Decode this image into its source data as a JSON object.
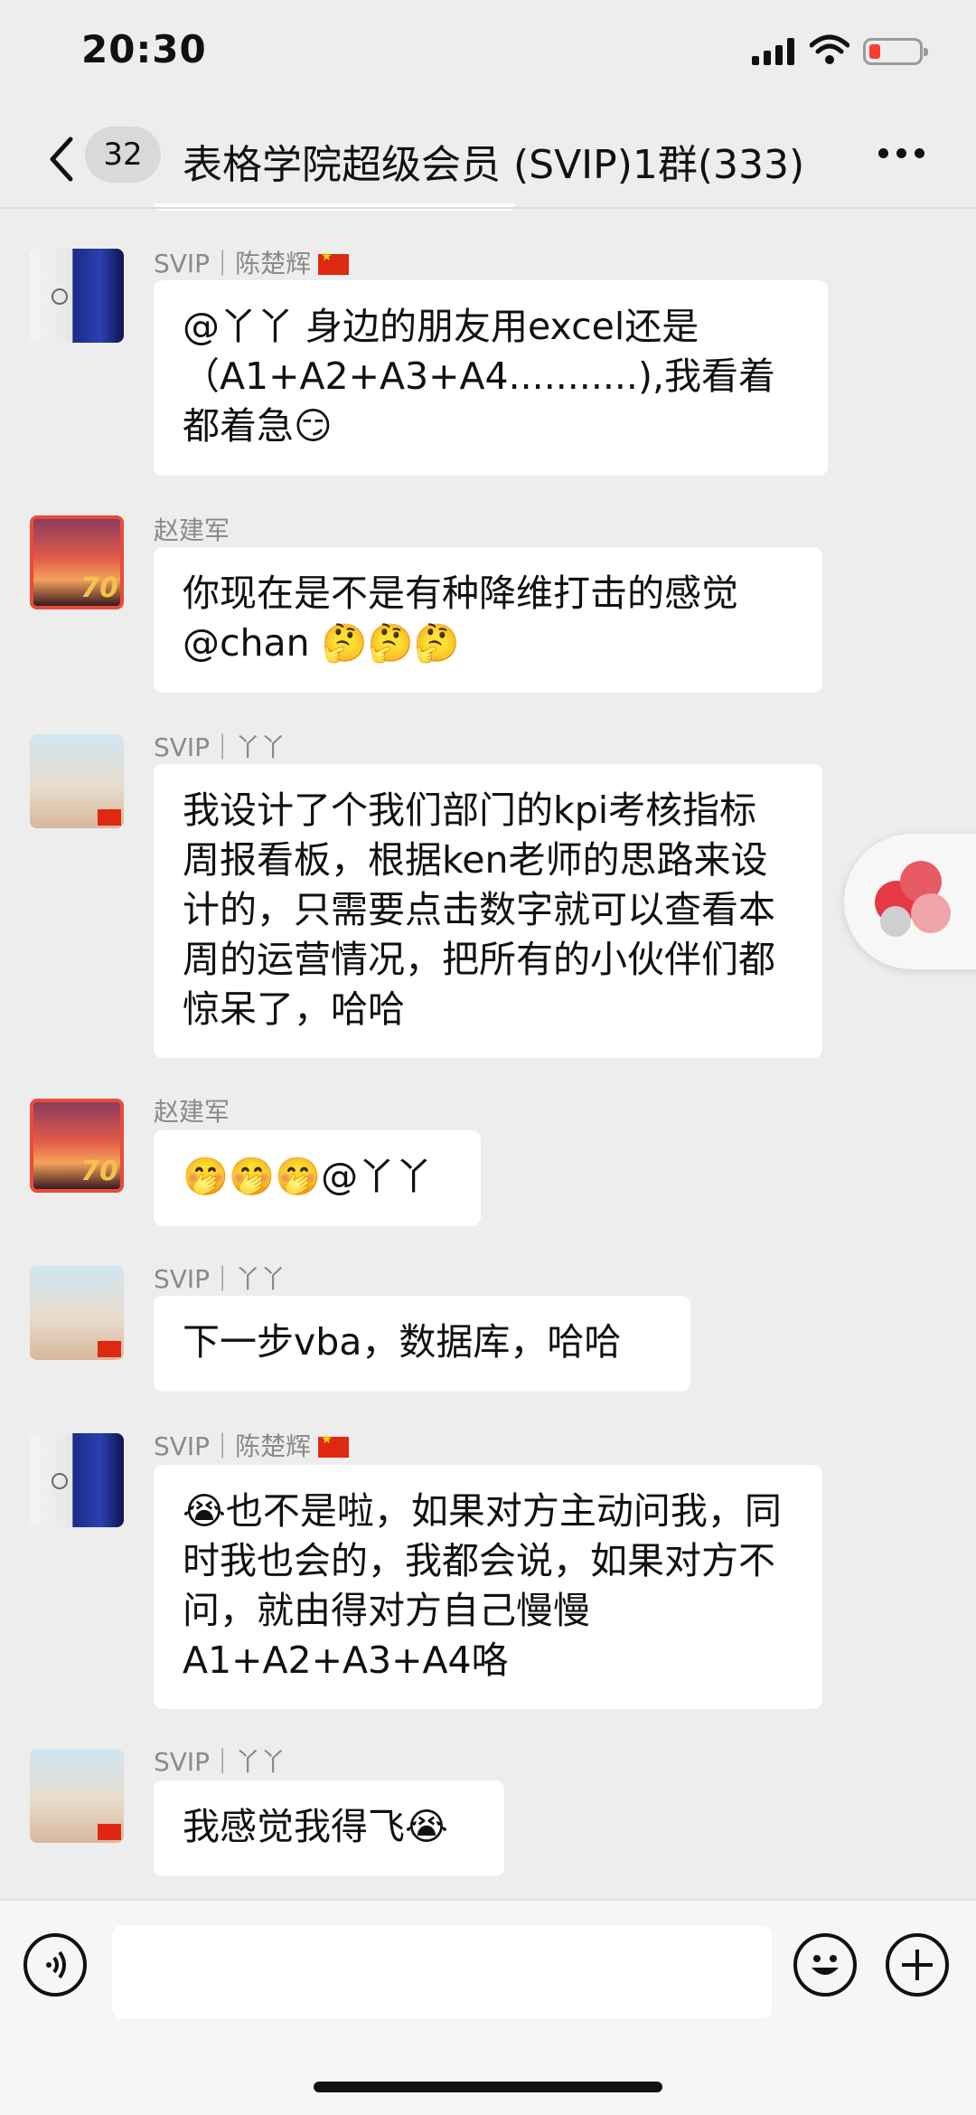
{
  "status_bar": {
    "time": "20:30"
  },
  "header": {
    "back_label": "<",
    "unread_count": "32",
    "title": "表格学院超级会员 (SVIP)1群(333)"
  },
  "messages": [
    {
      "sender": "SVIP｜陈楚辉",
      "has_flag": true,
      "avatar": "phone-avatar",
      "text": "@丫丫 身边的朋友用excel还是（A1+A2+A3+A4...........),我看着都着急😏"
    },
    {
      "sender": "赵建军",
      "has_flag": false,
      "avatar": "sunset-70-avatar",
      "text": "你现在是不是有种降维打击的感觉@chan 🤔🤔🤔"
    },
    {
      "sender": "SVIP｜丫丫",
      "has_flag": false,
      "avatar": "beach-avatar",
      "text": "我设计了个我们部门的kpi考核指标周报看板，根据ken老师的思路来设计的，只需要点击数字就可以查看本周的运营情况，把所有的小伙伴们都惊呆了，哈哈"
    },
    {
      "sender": "赵建军",
      "has_flag": false,
      "avatar": "sunset-70-avatar",
      "text": "🤭🤭🤭@丫丫"
    },
    {
      "sender": "SVIP｜丫丫",
      "has_flag": false,
      "avatar": "beach-avatar",
      "text": "下一步vba，数据库，哈哈"
    },
    {
      "sender": "SVIP｜陈楚辉",
      "has_flag": true,
      "avatar": "phone-avatar",
      "text": "😭也不是啦，如果对方主动问我，同时我也会的，我都会说，如果对方不问，就由得对方自己慢慢A1+A2+A3+A4咯"
    },
    {
      "sender": "SVIP｜丫丫",
      "has_flag": false,
      "avatar": "beach-avatar",
      "text": "我感觉我得飞😭"
    }
  ],
  "avatar_badge": "70",
  "input": {
    "placeholder": ""
  },
  "colors": {
    "background": "#ededed",
    "bubble": "#ffffff",
    "badge": "#d9d9d9",
    "flag": "#de2910"
  }
}
